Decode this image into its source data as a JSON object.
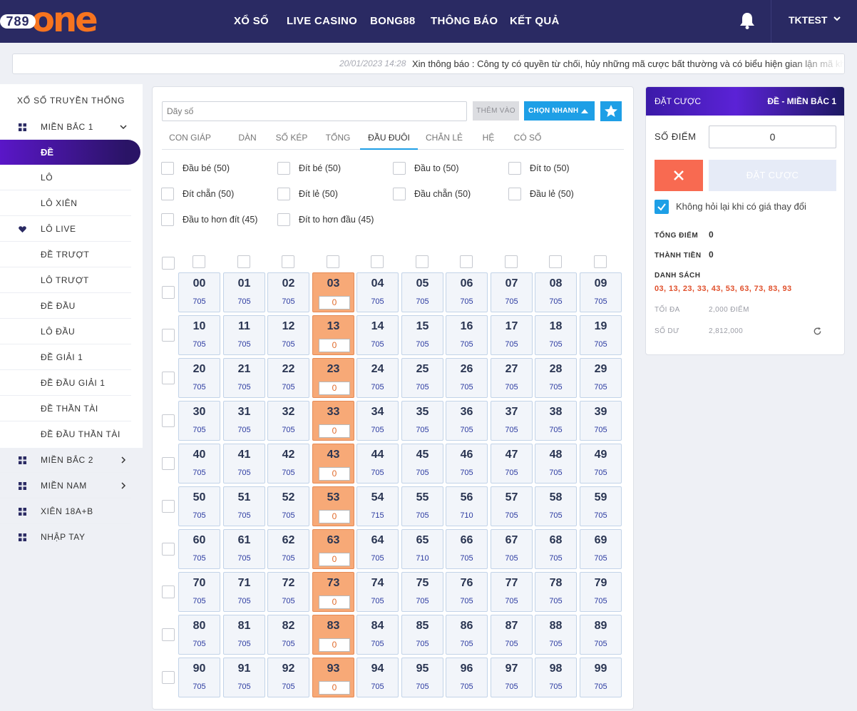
{
  "header": {
    "logo_num": "789",
    "logo_word": "one",
    "nav": [
      "XỔ SỐ",
      "LIVE CASINO",
      "BONG88",
      "THÔNG BÁO",
      "KẾT QUẢ"
    ],
    "user": "TKTEST",
    "colors": {
      "bg": "#2a2a63",
      "logo_orange": "#f7741f"
    }
  },
  "notice": {
    "time": "20/01/2023 14:28",
    "text": "Xin thông báo : Công ty có quyền từ chối, hủy những mã cược bất thường và có biểu hiện gian lận mã khô"
  },
  "sidebar": {
    "title": "XỔ SỐ TRUYỀN THỐNG",
    "group1": "MIỀN BẮC 1",
    "active": "ĐỀ",
    "sub": [
      "LÔ",
      "LÔ XIÊN",
      "LÔ LIVE",
      "ĐỀ TRƯỢT",
      "LÔ TRƯỢT",
      "ĐỀ ĐẦU",
      "LÔ ĐẦU",
      "ĐỀ GIẢI 1",
      "ĐỀ ĐẦU GIẢI 1",
      "ĐỀ THẦN TÀI",
      "ĐỀ ĐẦU THẦN TÀI"
    ],
    "groups": [
      "MIỀN BẮC 2",
      "MIỀN NAM",
      "XIÊN 18A+B",
      "NHẬP TAY"
    ]
  },
  "main": {
    "search_placeholder": "Dãy số",
    "add_label": "THÊM VÀO",
    "quick_label": "CHỌN NHANH",
    "tabs": [
      "CON GIÁP",
      "DÀN",
      "SỐ KÉP",
      "TỔNG",
      "ĐẦU ĐUÔI",
      "CHẴN LẺ",
      "HỆ",
      "CÓ SỐ"
    ],
    "active_tab": "ĐẦU ĐUÔI",
    "options": [
      "Đầu bé (50)",
      "Đít bé (50)",
      "Đầu to (50)",
      "Đít to (50)",
      "Đít chẵn (50)",
      "Đít lẻ (50)",
      "Đầu chẵn (50)",
      "Đầu lẻ (50)",
      "Đầu to hơn đít (45)",
      "Đít to hơn đầu (45)"
    ],
    "grid": {
      "default_odds": "705",
      "odds_overrides": {
        "54": "715",
        "56": "710",
        "65": "710"
      },
      "selected_col": 3,
      "selected_value": "0"
    }
  },
  "bet": {
    "title": "ĐẶT CƯỢC",
    "game": "ĐỀ - MIỀN BẮC 1",
    "score_label": "SỐ ĐIỂM",
    "score_value": "0",
    "bet_label": "ĐẶT CƯỢC",
    "checkbox_label": "Không hỏi lại khi có giá thay đổi",
    "total_label": "TỔNG ĐIỂM",
    "total_value": "0",
    "amount_label": "THÀNH TIỀN",
    "amount_value": "0",
    "list_label": "DANH SÁCH",
    "list_value": "03, 13, 23, 33, 43, 53, 63, 73, 83, 93",
    "max_label": "TỐI ĐA",
    "max_value": "2,000 ĐIỂM",
    "balance_label": "SỐ DƯ",
    "balance_value": "2,812,000"
  }
}
